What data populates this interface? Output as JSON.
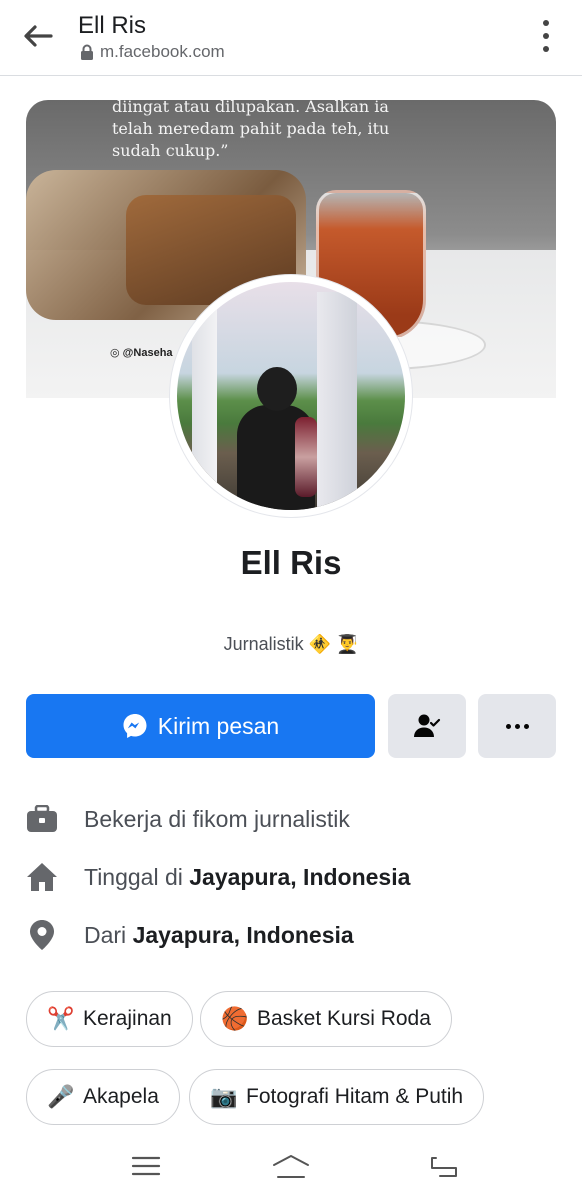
{
  "header": {
    "title": "Ell Ris",
    "url": "m.facebook.com"
  },
  "cover": {
    "quote": "diingat atau dilupakan. Asalkan ia telah meredam pahit pada teh, itu sudah cukup.”",
    "watermark": "@Naseha"
  },
  "profile": {
    "name": "Ell Ris",
    "bio": "Jurnalistik 🚸 👨‍🎓"
  },
  "actions": {
    "message_label": "Kirim pesan",
    "friend_icon": "person-check-icon",
    "more_icon": "more-dots-icon",
    "accent": "#1877f2"
  },
  "info": {
    "work_prefix": "Bekerja di fikom jurnalistik",
    "lives_prefix": "Tinggal di ",
    "lives_place": "Jayapura, Indonesia",
    "from_prefix": "Dari ",
    "from_place": "Jayapura, Indonesia"
  },
  "hobbies": [
    {
      "emoji": "✂️",
      "label": "Kerajinan"
    },
    {
      "emoji": "🏀",
      "label": "Basket Kursi Roda"
    },
    {
      "emoji": "🎤",
      "label": "Akapela"
    },
    {
      "emoji": "📷",
      "label": "Fotografi Hitam & Putih"
    }
  ],
  "nav": {
    "menu_icon": "menu-icon",
    "home_icon": "home-icon",
    "back_icon": "back-icon"
  }
}
